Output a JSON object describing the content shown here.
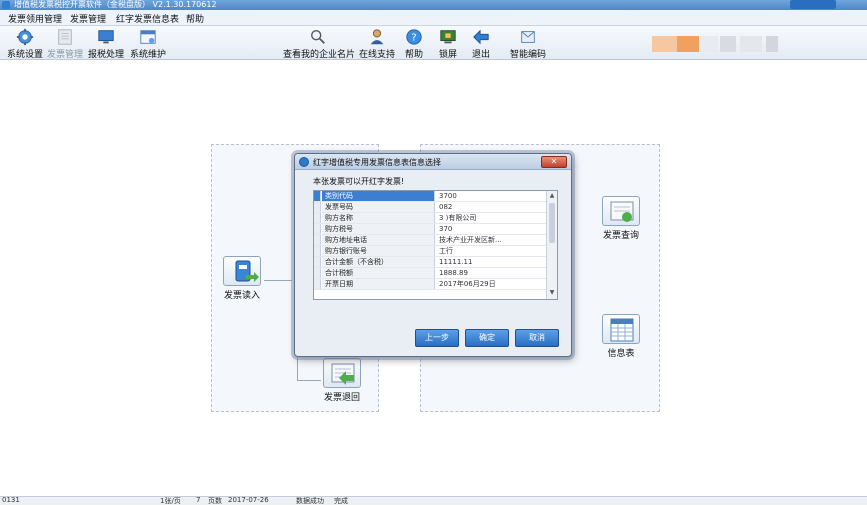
{
  "window": {
    "title": "增值税发票税控开票软件（金税盘版） V2.1.30.170612"
  },
  "menu": [
    {
      "label": "发票领用管理"
    },
    {
      "label": "发票管理"
    },
    {
      "label": "红字发票信息表"
    },
    {
      "label": "帮助"
    }
  ],
  "toolbar": {
    "left": [
      {
        "label": "系统设置",
        "enabled": true
      },
      {
        "label": "发票管理",
        "enabled": false
      },
      {
        "label": "报税处理",
        "enabled": true
      },
      {
        "label": "系统维护",
        "enabled": true
      }
    ],
    "right": [
      {
        "label": "查看我的企业名片"
      },
      {
        "label": "在线支持"
      },
      {
        "label": "帮助"
      },
      {
        "label": "锁屏"
      },
      {
        "label": "退出"
      },
      {
        "label": "智能编码"
      }
    ]
  },
  "workflow": {
    "invoice_read": "发票读入",
    "invoice_return": "发票退回",
    "invoice_query": "发票查询",
    "info_table": "信息表"
  },
  "dialog": {
    "title": "红字增值税专用发票信息表信息选择",
    "close": "✕",
    "message": "本张发票可以开红字发票!",
    "rows": [
      {
        "label": "类别代码",
        "value": "3700"
      },
      {
        "label": "发票号码",
        "value": "082"
      },
      {
        "label": "购方名称",
        "value": "3                    )有限公司"
      },
      {
        "label": "购方税号",
        "value": "370"
      },
      {
        "label": "购方地址电话",
        "value": "                    技术产业开发区新..."
      },
      {
        "label": "购方银行账号",
        "value": "工行"
      },
      {
        "label": "合计金额（不含税）",
        "value": "11111.11"
      },
      {
        "label": "合计税额",
        "value": "1888.89"
      },
      {
        "label": "开票日期",
        "value": "2017年06月29日"
      }
    ],
    "buttons": {
      "prev": "上一步",
      "ok": "确定",
      "cancel": "取消"
    }
  },
  "status": {
    "items": [
      "0131",
      "1张/页",
      "7",
      "页数",
      "2017-07-26",
      "数据成功",
      "完成"
    ]
  },
  "colors": {
    "accent": "#2a6ec4",
    "selected_row": "#3c7fd0",
    "title_bar": "#4f86c6"
  }
}
